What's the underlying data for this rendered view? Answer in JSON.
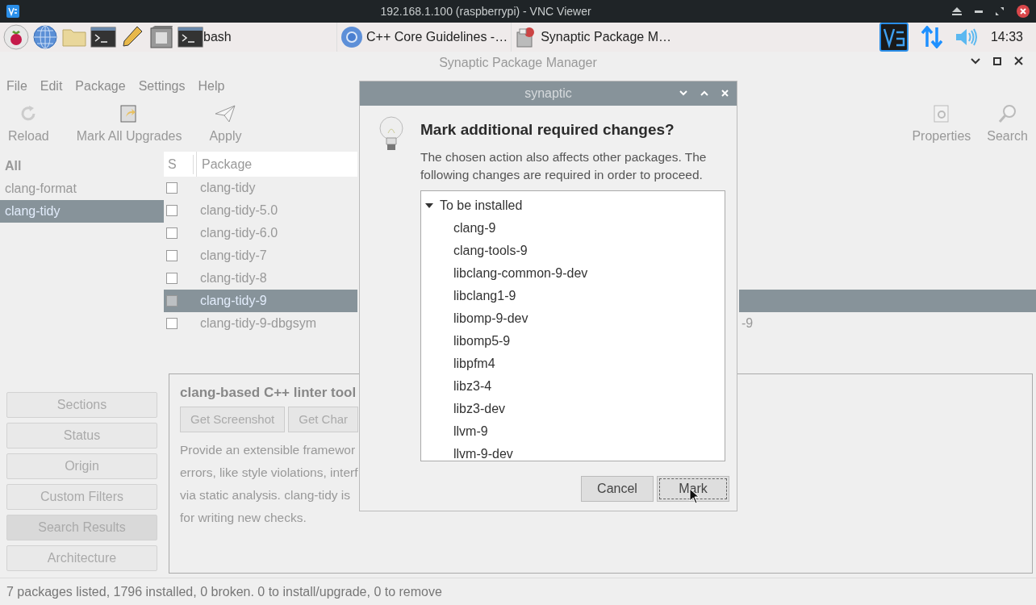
{
  "vnc_window": {
    "title": "192.168.1.100 (raspberrypi) - VNC Viewer"
  },
  "taskbar": {
    "launch_label": "bash",
    "tasks": [
      {
        "kind": "browser",
        "label": "C++ Core Guidelines -…"
      },
      {
        "kind": "package",
        "label": "Synaptic Package M…"
      }
    ],
    "clock": "14:33"
  },
  "window": {
    "title": "Synaptic Package Manager"
  },
  "menu": [
    "File",
    "Edit",
    "Package",
    "Settings",
    "Help"
  ],
  "toolbar": {
    "left": [
      {
        "kind": "reload",
        "label": "Reload"
      },
      {
        "kind": "upgrade",
        "label": "Mark All Upgrades"
      },
      {
        "kind": "apply",
        "label": "Apply"
      }
    ],
    "right": [
      {
        "kind": "properties",
        "label": "Properties"
      },
      {
        "kind": "search",
        "label": "Search"
      }
    ]
  },
  "filters": [
    {
      "kind": "header",
      "label": "All",
      "selected": false
    },
    {
      "kind": "item",
      "label": "clang-format",
      "selected": false
    },
    {
      "kind": "item",
      "label": "clang-tidy",
      "selected": true
    }
  ],
  "filter_buttons": [
    {
      "label": "Sections",
      "selected": false
    },
    {
      "label": "Status",
      "selected": false
    },
    {
      "label": "Origin",
      "selected": false
    },
    {
      "label": "Custom Filters",
      "selected": false
    },
    {
      "label": "Search Results",
      "selected": true
    },
    {
      "label": "Architecture",
      "selected": false
    }
  ],
  "package_table": {
    "columns": [
      "S",
      "Package"
    ],
    "rows": [
      {
        "checked": false,
        "selected": false,
        "package": "clang-tidy"
      },
      {
        "checked": false,
        "selected": false,
        "package": "clang-tidy-5.0"
      },
      {
        "checked": false,
        "selected": false,
        "package": "clang-tidy-6.0"
      },
      {
        "checked": false,
        "selected": false,
        "package": "clang-tidy-7"
      },
      {
        "checked": false,
        "selected": false,
        "package": "clang-tidy-8"
      },
      {
        "checked": false,
        "selected": true,
        "package": "clang-tidy-9"
      },
      {
        "checked": false,
        "selected": false,
        "package": "clang-tidy-9-dbgsym",
        "column_4": "-9"
      }
    ]
  },
  "description": {
    "title": "clang-based C++ linter tool",
    "buttons": [
      "Get Screenshot",
      "Get Char"
    ],
    "lines": [
      "Provide an extensible framewor",
      "errors, like style violations, interf",
      "via static analysis. clang-tidy is",
      "for writing new checks."
    ]
  },
  "status_bar": "7 packages listed, 1796 installed, 0 broken. 0 to install/upgrade, 0 to remove",
  "dialog": {
    "title": "synaptic",
    "heading": "Mark additional required changes?",
    "message": "The chosen action also affects other packages. The following changes are required in order to proceed.",
    "tree": {
      "label": "To be installed",
      "expanded": true,
      "children": [
        {
          "label": "clang-9"
        },
        {
          "label": "clang-tools-9"
        },
        {
          "label": "libclang-common-9-dev"
        },
        {
          "label": "libclang1-9"
        },
        {
          "label": "libomp-9-dev"
        },
        {
          "label": "libomp5-9"
        },
        {
          "label": "libpfm4"
        },
        {
          "label": "libz3-4"
        },
        {
          "label": "libz3-dev"
        },
        {
          "label": "llvm-9"
        },
        {
          "label": "llvm-9-dev"
        }
      ]
    },
    "buttons": [
      {
        "label": "Cancel",
        "focused": false
      },
      {
        "label": "Mark",
        "focused": true
      }
    ]
  }
}
